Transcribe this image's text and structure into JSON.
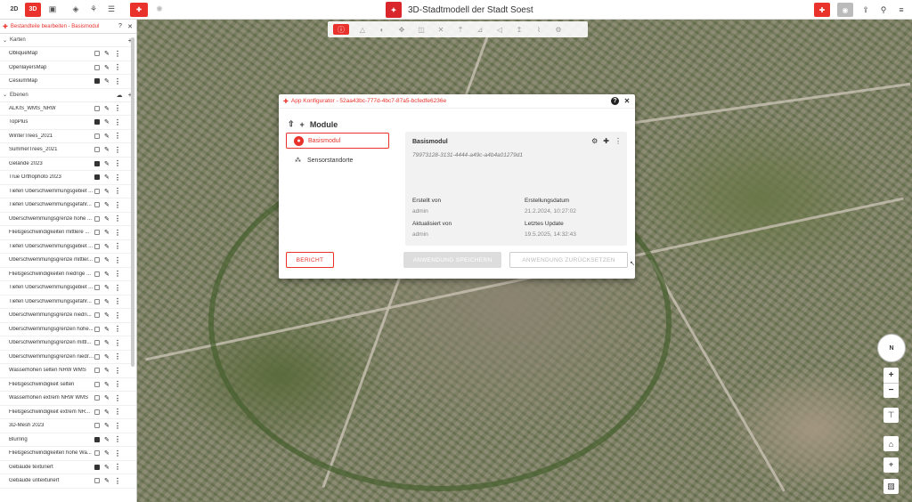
{
  "topbar": {
    "btn_2d": "2D",
    "btn_3d": "3D",
    "title": "3D-Stadtmodell der Stadt Soest",
    "icons": [
      "image-icon",
      "layers-icon",
      "tree-icon",
      "sliders-icon",
      "plugin-icon",
      "sun-icon"
    ],
    "right_icons": [
      "plugin-icon",
      "globe-icon",
      "share-icon",
      "search-icon",
      "menu-icon"
    ]
  },
  "sidebar": {
    "header": "Bestandteile bearbeiten - Basismodul",
    "sections": {
      "karten": "Karten",
      "ebenen": "Ebenen"
    },
    "karten": [
      {
        "label": "ObliqueMap",
        "checked": false
      },
      {
        "label": "OpenlayersMap",
        "checked": false
      },
      {
        "label": "CesiumMap",
        "checked": true
      }
    ],
    "ebenen": [
      {
        "label": "ALKIS_WMS_NRW",
        "checked": false
      },
      {
        "label": "TopPlus",
        "checked": true
      },
      {
        "label": "WinterTrees_2021",
        "checked": false
      },
      {
        "label": "SummerTrees_2021",
        "checked": false
      },
      {
        "label": "Gelände 2023",
        "checked": true
      },
      {
        "label": "True Orthophoto 2023",
        "checked": true
      },
      {
        "label": "Tiefen Überschwemmungsgebiet ...",
        "checked": false
      },
      {
        "label": "Tiefen Überschwemmungsgefähr...",
        "checked": false
      },
      {
        "label": "Überschwemmungsgrenze hohe ...",
        "checked": false
      },
      {
        "label": "Fließgeschwindigkeiten mittlere ...",
        "checked": false
      },
      {
        "label": "Tiefen Überschwemmungsgebiet ...",
        "checked": false
      },
      {
        "label": "Überschwemmungsgrenze mittler...",
        "checked": false
      },
      {
        "label": "Fließgeschwindigkeiten niedrige ...",
        "checked": false
      },
      {
        "label": "Tiefen Überschwemmungsgebiet ...",
        "checked": false
      },
      {
        "label": "Tiefen Überschwemmungsgefähr...",
        "checked": false
      },
      {
        "label": "Überschwemmungsgrenze niedri...",
        "checked": false
      },
      {
        "label": "Überschwemmungsgrenzen hohe...",
        "checked": false
      },
      {
        "label": "Überschwemmungsgrenzen mittl...",
        "checked": false
      },
      {
        "label": "Überschwemmungsgrenzen niedri...",
        "checked": false
      },
      {
        "label": "Wasserhöhen selten NRW WMS",
        "checked": false
      },
      {
        "label": "Fließgeschwindigkeit selten",
        "checked": false
      },
      {
        "label": "Wasserhöhen extrem NRW WMS",
        "checked": false
      },
      {
        "label": "Fließgeschwindigkeit extrem NR...",
        "checked": false
      },
      {
        "label": "3D-Mesh 2023",
        "checked": false
      },
      {
        "label": "Blurring",
        "checked": true
      },
      {
        "label": "Fließgeschwindigkeiten hohe Wa...",
        "checked": false
      },
      {
        "label": "Gebäude texturiert",
        "checked": true
      },
      {
        "label": "Gebäude untexturiert",
        "checked": false
      }
    ]
  },
  "dialog": {
    "title": "App Konfigurator - 52aa43bc-777d-4bc7-87a5-bcfedfe6236e",
    "module_header": "Module",
    "modules": [
      {
        "label": "Basismodul",
        "selected": true
      },
      {
        "label": "Sensorstandorte",
        "selected": false
      }
    ],
    "detail": {
      "title": "Basismodul",
      "id": "79973128-3131-4444-a49c-a4b4a01279d1",
      "created_by_label": "Erstellt von",
      "created_by": "admin",
      "created_date_label": "Erstellungsdatum",
      "created_date": "21.2.2024, 10:27:02",
      "updated_by_label": "Aktualisiert von",
      "updated_by": "admin",
      "updated_date_label": "Letztes Update",
      "updated_date": "19.5.2025, 14:32:43"
    },
    "btn_report": "BERICHT",
    "btn_save": "ANWENDUNG SPEICHERN",
    "btn_reset": "ANWENDUNG ZURÜCKSETZEN"
  },
  "map": {
    "compass_label": "N"
  },
  "colors": {
    "accent": "#e8322b"
  }
}
